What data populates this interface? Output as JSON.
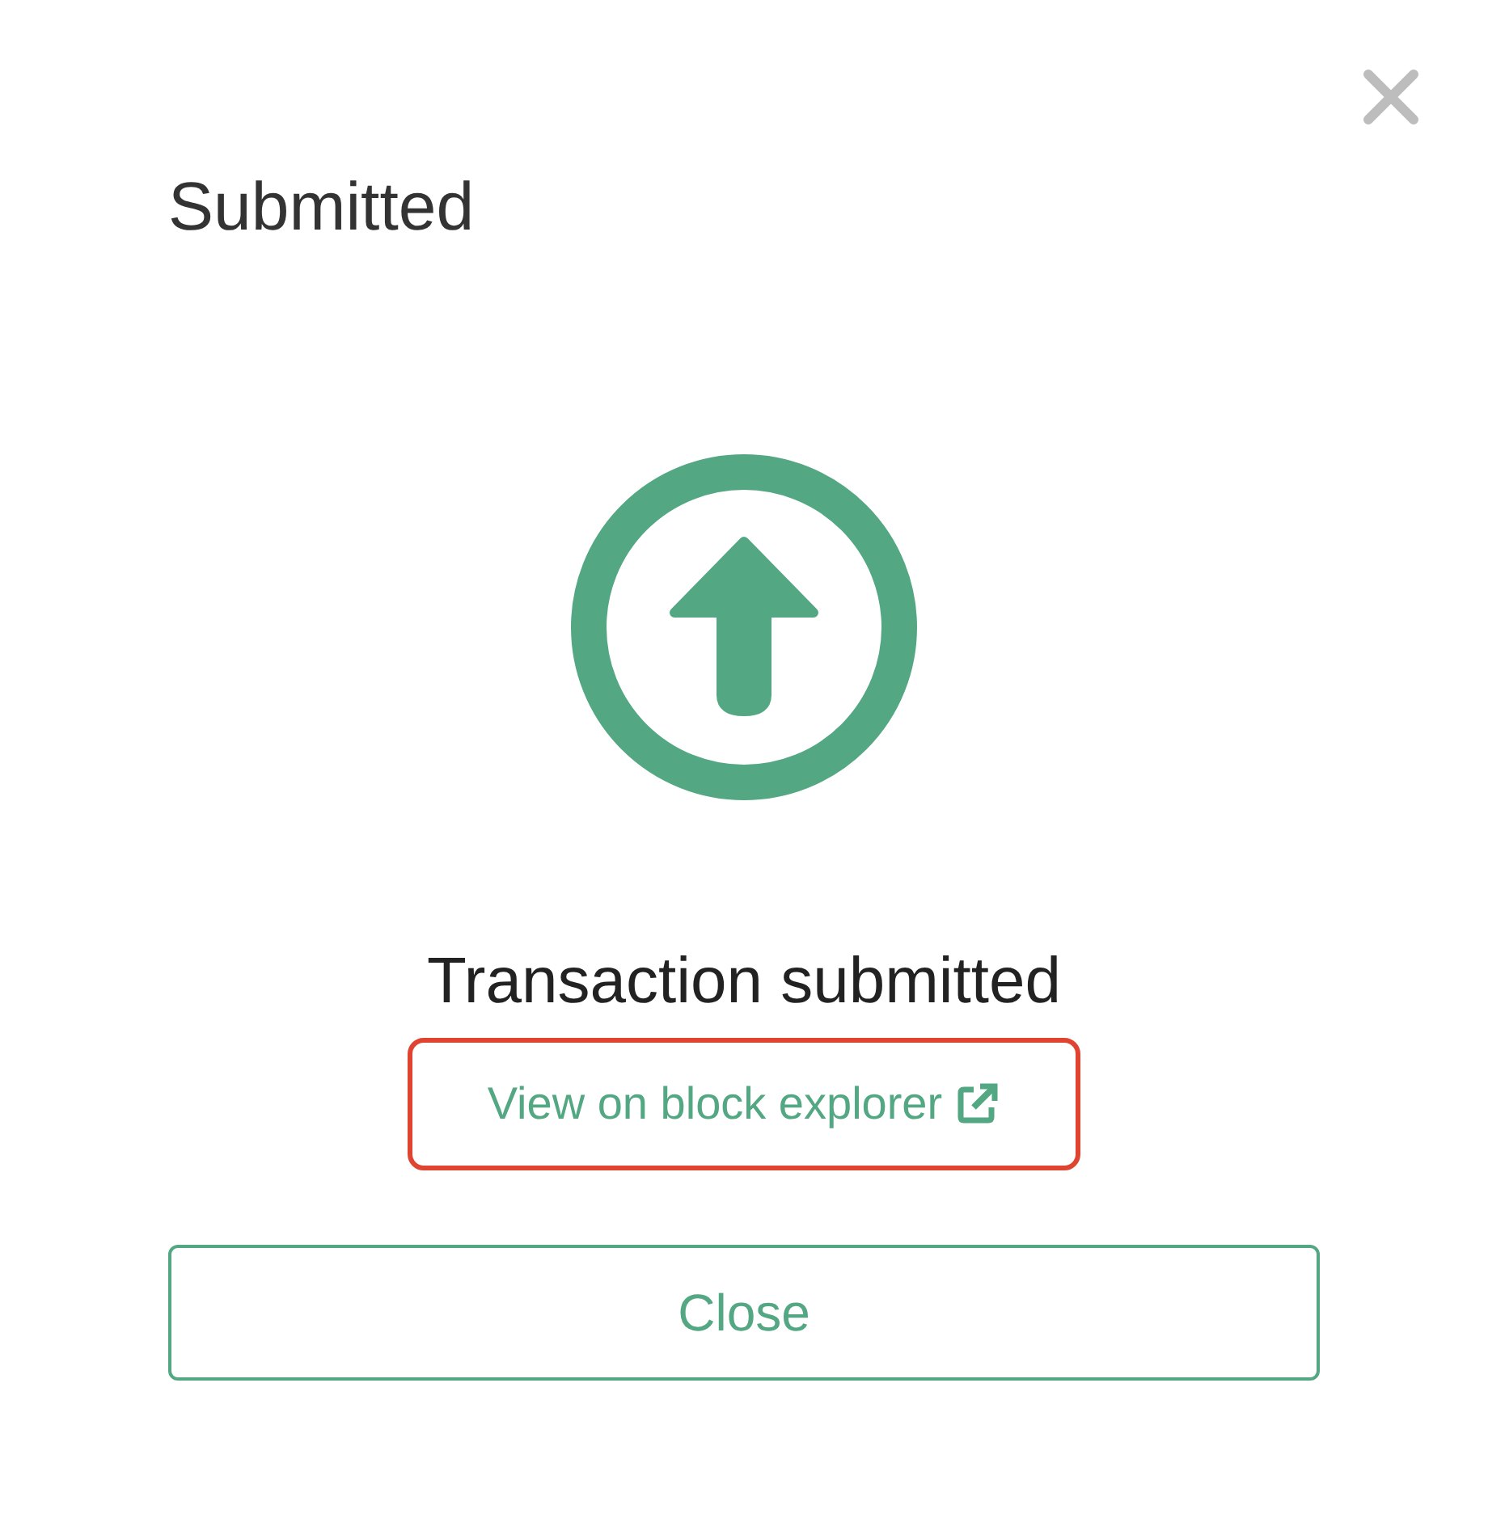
{
  "dialog": {
    "title": "Submitted",
    "message": "Transaction submitted",
    "link": {
      "label": "View on block explorer",
      "highlighted": true
    },
    "button": {
      "label": "Close"
    }
  }
}
